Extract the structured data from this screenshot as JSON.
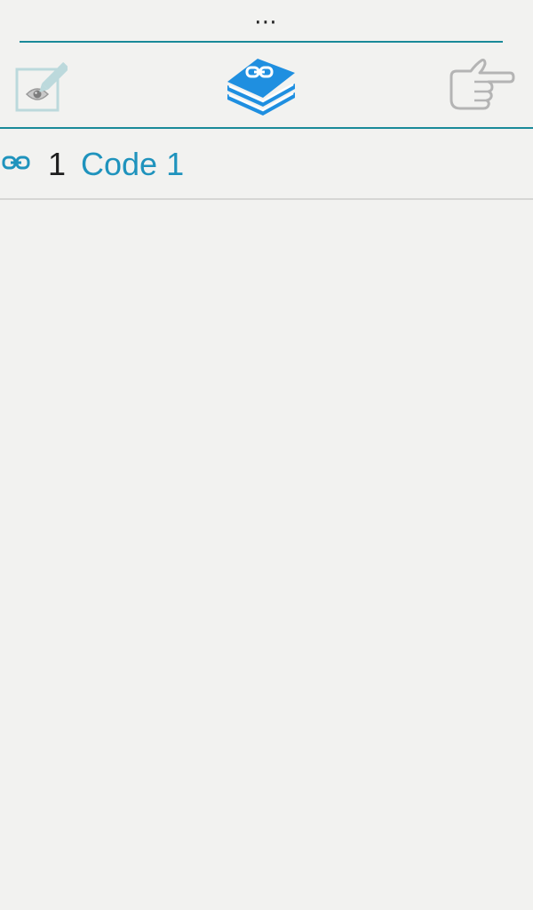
{
  "header": {
    "overflow_menu": "⋯"
  },
  "toolbar": {
    "buttons": [
      {
        "name": "edit-view",
        "icon": "edit-eye-icon"
      },
      {
        "name": "code-book",
        "icon": "link-book-icon",
        "color": "#1f8fe0"
      },
      {
        "name": "next",
        "icon": "pointing-hand-icon"
      }
    ]
  },
  "list": {
    "items": [
      {
        "icon": "link-icon",
        "number": "1",
        "label": "Code 1"
      }
    ]
  },
  "colors": {
    "accent": "#1a8a99",
    "link": "#1f93bd",
    "background": "#f2f2f0"
  }
}
